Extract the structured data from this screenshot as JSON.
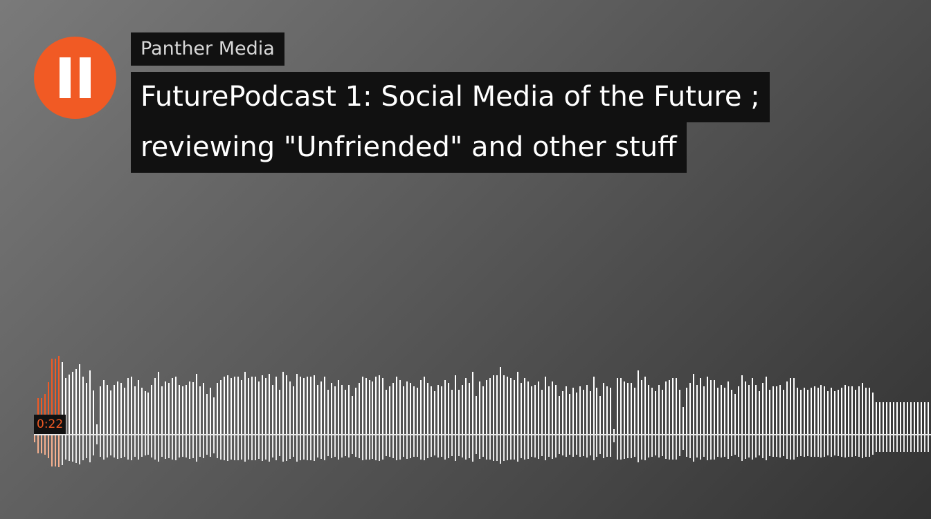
{
  "player": {
    "state": "playing",
    "pause_icon": "pause-icon",
    "accent_color": "#f15a24",
    "artist": "Panther Media",
    "title_lines": [
      "FuturePodcast 1: Social Media of the Future ;",
      "reviewing \"Unfriended\" and other stuff"
    ],
    "current_time": "0:22"
  },
  "waveform": {
    "played_fraction": 0.03,
    "played_color": "#f15a24",
    "unplayed_color": "#ffffff",
    "bar_count": 258,
    "levels": [
      0.05,
      0.45,
      0.45,
      0.5,
      0.65,
      0.95,
      0.95,
      0.98,
      0.9,
      0.7,
      0.75,
      0.78,
      0.82,
      0.88,
      0.72,
      0.64,
      0.8,
      0.55,
      0.12,
      0.6,
      0.68,
      0.62,
      0.55,
      0.62,
      0.66,
      0.64,
      0.58,
      0.7,
      0.72,
      0.6,
      0.68,
      0.58,
      0.54,
      0.52,
      0.62,
      0.7,
      0.78,
      0.6,
      0.66,
      0.64,
      0.7,
      0.72,
      0.62,
      0.6,
      0.62,
      0.66,
      0.65,
      0.76,
      0.6,
      0.64,
      0.5,
      0.58,
      0.46,
      0.64,
      0.68,
      0.72,
      0.74,
      0.7,
      0.72,
      0.72,
      0.68,
      0.78,
      0.7,
      0.72,
      0.72,
      0.66,
      0.74,
      0.7,
      0.76,
      0.62,
      0.72,
      0.56,
      0.78,
      0.74,
      0.66,
      0.6,
      0.76,
      0.72,
      0.7,
      0.72,
      0.72,
      0.74,
      0.62,
      0.66,
      0.72,
      0.56,
      0.64,
      0.6,
      0.68,
      0.62,
      0.56,
      0.62,
      0.48,
      0.58,
      0.64,
      0.72,
      0.7,
      0.68,
      0.66,
      0.72,
      0.74,
      0.7,
      0.56,
      0.6,
      0.64,
      0.72,
      0.68,
      0.6,
      0.66,
      0.64,
      0.6,
      0.58,
      0.68,
      0.72,
      0.64,
      0.6,
      0.54,
      0.62,
      0.6,
      0.68,
      0.64,
      0.56,
      0.74,
      0.56,
      0.62,
      0.7,
      0.64,
      0.78,
      0.48,
      0.66,
      0.6,
      0.68,
      0.7,
      0.74,
      0.74,
      0.84,
      0.74,
      0.72,
      0.7,
      0.68,
      0.78,
      0.64,
      0.7,
      0.66,
      0.6,
      0.62,
      0.66,
      0.56,
      0.72,
      0.6,
      0.66,
      0.62,
      0.48,
      0.54,
      0.6,
      0.5,
      0.58,
      0.52,
      0.6,
      0.56,
      0.62,
      0.54,
      0.72,
      0.58,
      0.48,
      0.64,
      0.6,
      0.58,
      0.06,
      0.7,
      0.7,
      0.66,
      0.64,
      0.64,
      0.58,
      0.8,
      0.68,
      0.72,
      0.62,
      0.58,
      0.54,
      0.62,
      0.56,
      0.66,
      0.68,
      0.7,
      0.7,
      0.56,
      0.34,
      0.58,
      0.64,
      0.76,
      0.62,
      0.7,
      0.6,
      0.72,
      0.68,
      0.68,
      0.58,
      0.62,
      0.58,
      0.66,
      0.56,
      0.5,
      0.6,
      0.74,
      0.66,
      0.62,
      0.7,
      0.62,
      0.54,
      0.64,
      0.72,
      0.56,
      0.6,
      0.6,
      0.62,
      0.56,
      0.66,
      0.7,
      0.7,
      0.58,
      0.56,
      0.58,
      0.56,
      0.58,
      0.6,
      0.58,
      0.62,
      0.6,
      0.54,
      0.58,
      0.54,
      0.56,
      0.58,
      0.62,
      0.6,
      0.6,
      0.56,
      0.6,
      0.64,
      0.58,
      0.58,
      0.52,
      0.4,
      0.4,
      0.4,
      0.4,
      0.4,
      0.4,
      0.4,
      0.4,
      0.4,
      0.4,
      0.4,
      0.4,
      0.4,
      0.4,
      0.4,
      0.4
    ]
  }
}
